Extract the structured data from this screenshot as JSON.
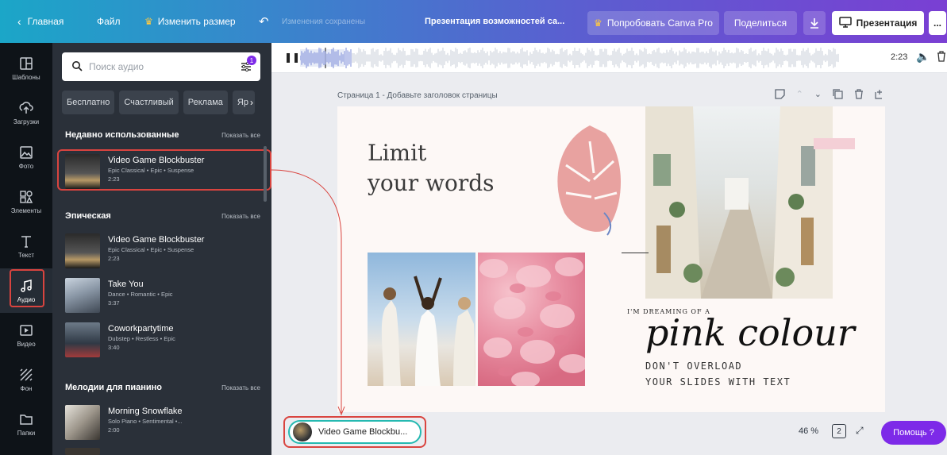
{
  "topbar": {
    "home": "Главная",
    "file": "Файл",
    "resize": "Изменить размер",
    "saved_status": "Изменения сохранены",
    "doc_title": "Презентация возможностей са...",
    "try_pro": "Попробовать Canva Pro",
    "share": "Поделиться",
    "present": "Презентация",
    "more": "..."
  },
  "rail": {
    "items": [
      {
        "label": "Шаблоны",
        "icon": "templates-icon"
      },
      {
        "label": "Загрузки",
        "icon": "upload-icon"
      },
      {
        "label": "Фото",
        "icon": "photo-icon"
      },
      {
        "label": "Элементы",
        "icon": "elements-icon"
      },
      {
        "label": "Текст",
        "icon": "text-icon"
      },
      {
        "label": "Аудио",
        "icon": "audio-icon"
      },
      {
        "label": "Видео",
        "icon": "video-icon"
      },
      {
        "label": "Фон",
        "icon": "background-icon"
      },
      {
        "label": "Папки",
        "icon": "folder-icon"
      }
    ]
  },
  "panel": {
    "search_placeholder": "Поиск аудио",
    "filter_badge": "1",
    "chips": [
      "Бесплатно",
      "Счастливый",
      "Реклама",
      "Яр"
    ],
    "recent": {
      "title": "Недавно использованные",
      "show_all": "Показать все",
      "tracks": [
        {
          "title": "Video Game Blockbuster",
          "sub": "Epic Classical • Epic • Suspense",
          "duration": "2:23"
        }
      ]
    },
    "epic": {
      "title": "Эпическая",
      "show_all": "Показать все",
      "tracks": [
        {
          "title": "Video Game Blockbuster",
          "sub": "Epic Classical • Epic • Suspense",
          "duration": "2:23"
        },
        {
          "title": "Take You",
          "sub": "Dance • Romantic • Epic",
          "duration": "3:37"
        },
        {
          "title": "Coworkpartytime",
          "sub": "Dubstep • Restless • Epic",
          "duration": "3:40"
        }
      ]
    },
    "piano": {
      "title": "Мелодии для пианино",
      "show_all": "Показать все",
      "tracks": [
        {
          "title": "Morning Snowflake",
          "sub": "Solo Piano • Sentimental •...",
          "duration": "2:00"
        }
      ]
    }
  },
  "audio_bar": {
    "time": "2:23"
  },
  "page": {
    "label": "Страница 1 - Добавьте заголовок страницы"
  },
  "slide": {
    "headline_1": "Limit",
    "headline_2": "your words",
    "dreaming": "I'M DREAMING OF A",
    "pink": "pink colour",
    "dont_1": "DON'T OVERLOAD",
    "dont_2": "YOUR SLIDES WITH TEXT"
  },
  "bottom": {
    "now_playing": "Video Game Blockbu...",
    "zoom": "46 %",
    "page_count": "2",
    "help": "Помощь ?"
  },
  "colors": {
    "accent_purple": "#7d2ae8",
    "highlight_red": "#d9443f",
    "teal": "#25b9b1"
  }
}
